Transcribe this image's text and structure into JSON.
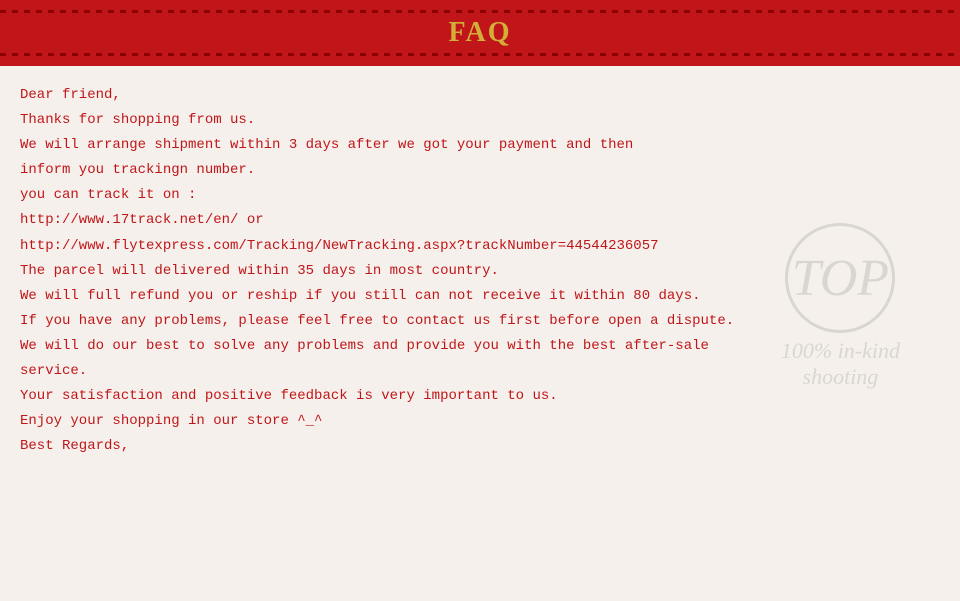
{
  "header": {
    "title": "FAQ",
    "bg_color": "#c0161a",
    "title_color": "#d4af37"
  },
  "content": {
    "lines": [
      {
        "id": "line1",
        "text": "Dear friend,"
      },
      {
        "id": "line2",
        "text": "Thanks for shopping from us."
      },
      {
        "id": "line3",
        "text": "We will arrange shipment within 3 days after we got your payment and then"
      },
      {
        "id": "line4",
        "text": "inform you trackingn number."
      },
      {
        "id": "line5",
        "text": "you can track it on :"
      },
      {
        "id": "line6",
        "text": "http://www.17track.net/en/                          or"
      },
      {
        "id": "line7",
        "text": "http://www.flytexpress.com/Tracking/NewTracking.aspx?trackNumber=44544236057"
      },
      {
        "id": "line8",
        "text": "The parcel will delivered within 35 days in most country."
      },
      {
        "id": "line9",
        "text": "We will full refund you or reship if you still can not receive it within 80 days."
      },
      {
        "id": "line10",
        "text": "If you have any problems, please feel free to contact us first before open a dispute."
      },
      {
        "id": "line11",
        "text": "We will do our best to solve any problems and provide you with the best after-sale"
      },
      {
        "id": "line12",
        "text": "service."
      },
      {
        "id": "line13",
        "text": "Your satisfaction and positive feedback is very important to us."
      },
      {
        "id": "line14",
        "text": "Enjoy your shopping in our store ^_^"
      },
      {
        "id": "line15",
        "text": "Best Regards,"
      }
    ]
  },
  "watermark": {
    "circle_text": "TOP",
    "bottom_text": "100% in-kind\nshooting"
  }
}
